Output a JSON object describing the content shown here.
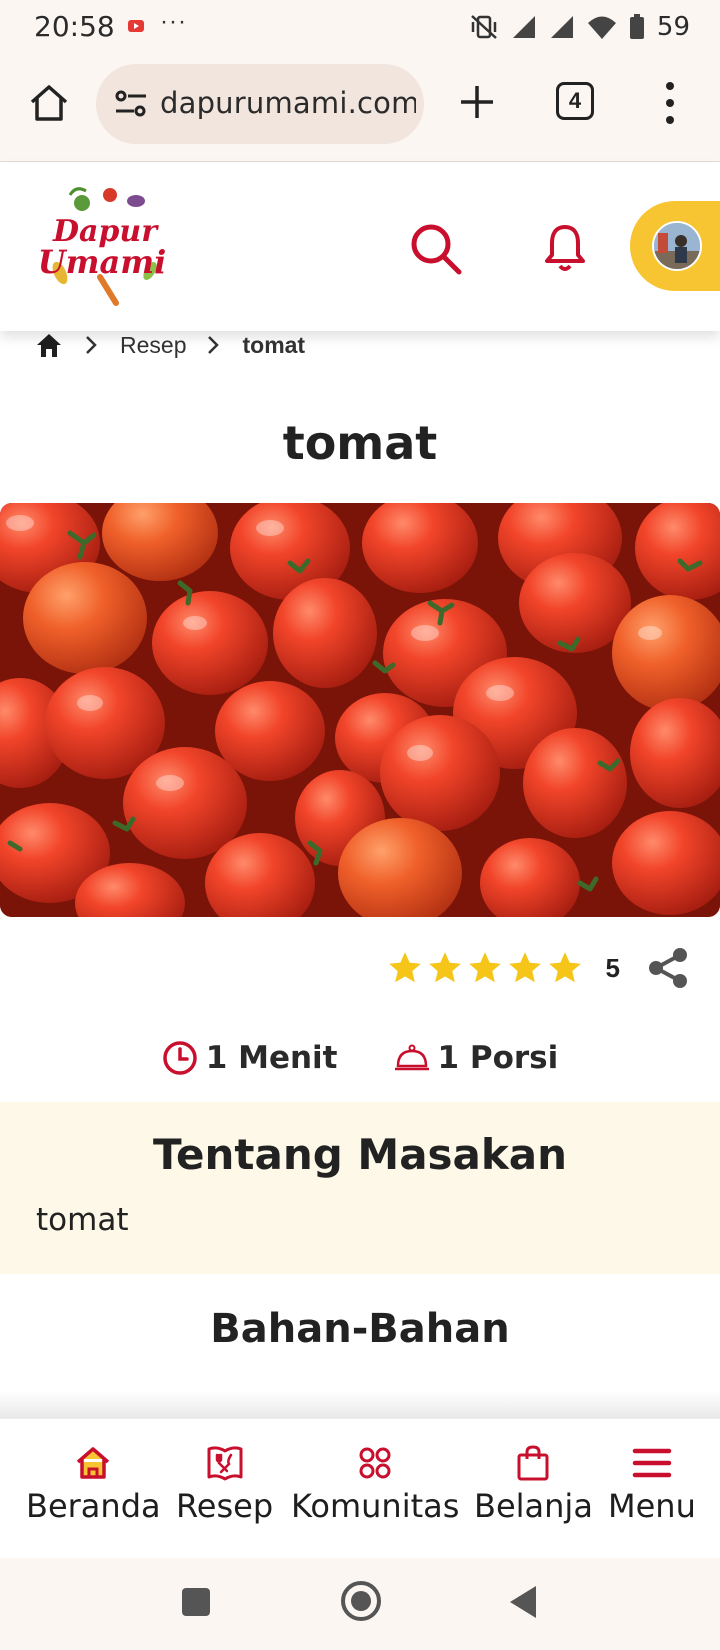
{
  "status_bar": {
    "time": "20:58",
    "notification_dots": "···",
    "battery": "59"
  },
  "browser": {
    "url": "dapurumami.com",
    "tab_count": "4"
  },
  "site": {
    "logo_line1": "Dapur",
    "logo_line2": "Umami",
    "brand_color": "#c8102e",
    "accent_color": "#f7c531"
  },
  "breadcrumb": {
    "items": [
      "Resep",
      "tomat"
    ]
  },
  "recipe": {
    "title": "tomat",
    "rating_value": "5",
    "stars_filled": 5,
    "time": "1 Menit",
    "portions": "1 Porsi",
    "about_title": "Tentang Masakan",
    "about_text": "tomat",
    "ingredients_title": "Bahan-Bahan"
  },
  "bottom_nav": {
    "items": [
      "Beranda",
      "Resep",
      "Komunitas",
      "Belanja",
      "Menu"
    ]
  }
}
